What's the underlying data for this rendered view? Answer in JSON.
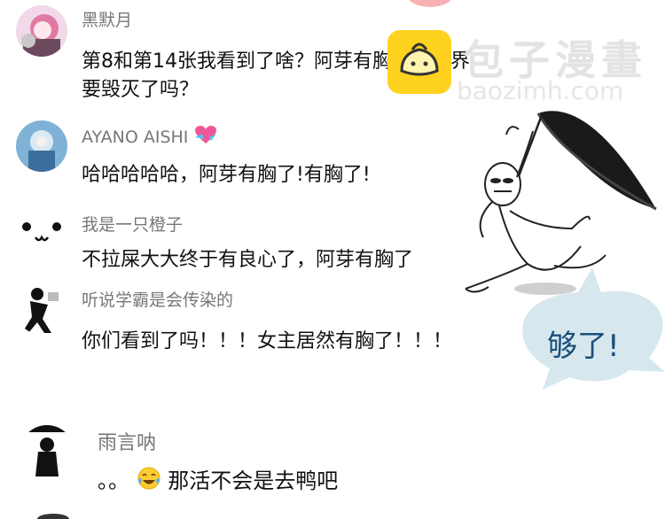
{
  "comments": [
    {
      "username": "黑默月",
      "text_line1": "第8和第14张我看到了啥？阿芽有胸了？世界",
      "text_line2": "要毁灭了吗？"
    },
    {
      "username": "AYANO AISHI",
      "username_icon": "heart-with-ribbon-icon",
      "text": "哈哈哈哈哈，阿芽有胸了!有胸了!"
    },
    {
      "username": "我是一只橙子",
      "text": "不拉屎大大终于有良心了，阿芽有胸了"
    },
    {
      "username": "听说学霸是会传染的",
      "text": "你们看到了吗！！！女主居然有胸了！！！"
    },
    {
      "username": "雨言呐",
      "text": "。。",
      "emoji": "tears-of-joy-icon",
      "text_after_emoji": "那活不会是去鸭吧"
    }
  ],
  "watermark": {
    "name": "包子漫畫",
    "url": "baozimh.com"
  },
  "sticker": {
    "caption": "够了!"
  },
  "colors": {
    "username": "#777777",
    "text": "#111111",
    "logo": "#ffd21f",
    "bubble": "#d6e8ee",
    "bubble_text": "#1a4e7a"
  }
}
